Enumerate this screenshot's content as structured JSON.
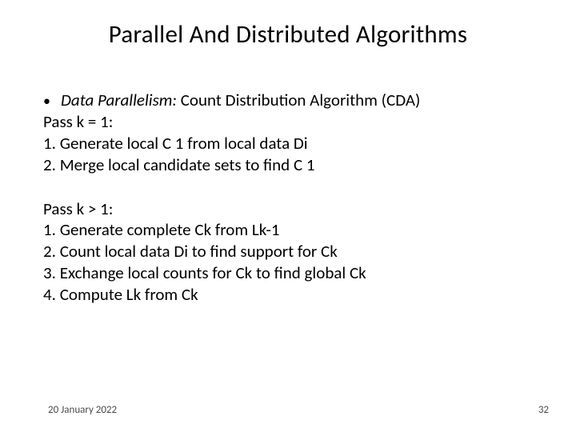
{
  "title": "Parallel And Distributed Algorithms",
  "bullet": {
    "term": "Data Parallelism:",
    "rest": "  Count Distribution Algorithm (CDA)"
  },
  "pass1": {
    "heading": "Pass k = 1:",
    "l1": "1. Generate local C 1 from local data Di",
    "l2": "2. Merge local candidate sets to find C 1"
  },
  "pass2": {
    "heading": "Pass k > 1:",
    "l1": "1. Generate complete Ck from Lk-1",
    "l2": "2. Count local data Di to find support for Ck",
    "l3": "3. Exchange local counts for Ck to find global Ck",
    "l4": "4. Compute Lk from Ck"
  },
  "footer": {
    "date": "20 January 2022",
    "page": "32"
  }
}
